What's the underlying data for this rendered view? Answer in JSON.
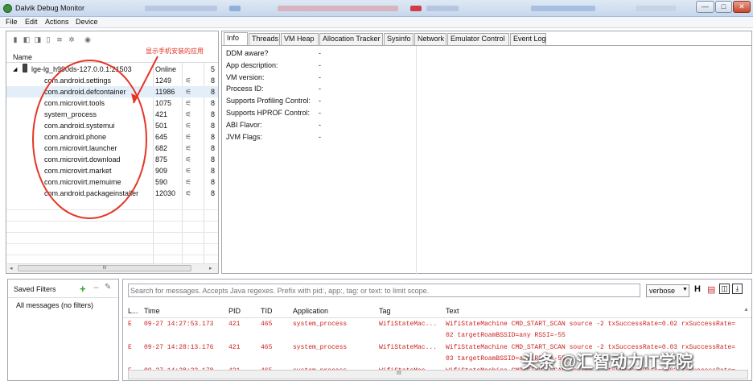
{
  "window": {
    "title": "Dalvik Debug Monitor",
    "controls": [
      "—",
      "□",
      "✕"
    ]
  },
  "menu": [
    "File",
    "Edit",
    "Actions",
    "Device"
  ],
  "left_toolbar_icons": [
    "debug-icon",
    "update-heap-icon",
    "heap-dump-icon",
    "stop-icon",
    "threads-icon",
    "alloc-icon",
    "screenshot-icon"
  ],
  "device_panel": {
    "column_name": "Name",
    "device": {
      "name": "lge-lg_h990ds-127.0.0.1:21503",
      "status": "Online",
      "extra": "5"
    },
    "processes": [
      {
        "name": "com.android.settings",
        "pid": "1249",
        "port": "8"
      },
      {
        "name": "com.android.defcontainer",
        "pid": "11986",
        "port": "8"
      },
      {
        "name": "com.microvirt.tools",
        "pid": "1075",
        "port": "8"
      },
      {
        "name": "system_process",
        "pid": "421",
        "port": "8"
      },
      {
        "name": "com.android.systemui",
        "pid": "501",
        "port": "8"
      },
      {
        "name": "com.android.phone",
        "pid": "645",
        "port": "8"
      },
      {
        "name": "com.microvirt.launcher",
        "pid": "682",
        "port": "8"
      },
      {
        "name": "com.microvirt.download",
        "pid": "875",
        "port": "8"
      },
      {
        "name": "com.microvirt.market",
        "pid": "909",
        "port": "8"
      },
      {
        "name": "com.microvirt.memuime",
        "pid": "590",
        "port": "8"
      },
      {
        "name": "com.android.packageinstaller",
        "pid": "12030",
        "port": "8"
      }
    ],
    "scroll_label": "III"
  },
  "annotation": {
    "text": "显示手机安装的应用",
    "color": "#e53525"
  },
  "tabs": [
    "Info",
    "Threads",
    "VM Heap",
    "Allocation Tracker",
    "Sysinfo",
    "Network",
    "Emulator Control",
    "Event Log"
  ],
  "info_rows": [
    {
      "label": "DDM aware?",
      "value": "-"
    },
    {
      "label": "App description:",
      "value": "-"
    },
    {
      "label": "VM version:",
      "value": "-"
    },
    {
      "label": "Process ID:",
      "value": "-"
    },
    {
      "label": "Supports Profiling Control:",
      "value": "-"
    },
    {
      "label": "Supports HPROF Control:",
      "value": "-"
    },
    {
      "label": "ABI Flavor:",
      "value": "-"
    },
    {
      "label": "JVM Flags:",
      "value": "-"
    }
  ],
  "filters": {
    "title": "Saved Filters",
    "items": [
      "All messages (no filters)"
    ]
  },
  "logcat": {
    "search_placeholder": "Search for messages. Accepts Java regexes. Prefix with pid:, app:, tag: or text: to limit scope.",
    "level_select": "verbose",
    "columns": [
      "L...",
      "Time",
      "PID",
      "TID",
      "Application",
      "Tag",
      "Text"
    ],
    "rows": [
      {
        "level": "E",
        "time": "09-27 14:27:53.173",
        "pid": "421",
        "tid": "465",
        "app": "system_process",
        "tag": "WifiStateMac...",
        "text": "WifiStateMachine CMD_START_SCAN source -2 txSuccessRate=0.02 rxSuccessRate=",
        "text2": "02 targetRoamBSSID=any RSSI=-55"
      },
      {
        "level": "E",
        "time": "09-27 14:28:13.176",
        "pid": "421",
        "tid": "465",
        "app": "system_process",
        "tag": "WifiStateMac...",
        "text": "WifiStateMachine CMD_START_SCAN source -2 txSuccessRate=0.03 rxSuccessRate=",
        "text2": "03 targetRoamBSSID=any RSSI=-55"
      },
      {
        "level": "E",
        "time": "09-27 14:28:33.178",
        "pid": "421",
        "tid": "465",
        "app": "system_process",
        "tag": "WifiStateMac...",
        "text": "WifiStateMachine CMD_START_SCAN source -2 txSuccessRate=0.02 rxSuccessRate=",
        "text2": ""
      }
    ],
    "scroll_label": "III"
  },
  "watermark": "头条 @汇智动力IT学院"
}
